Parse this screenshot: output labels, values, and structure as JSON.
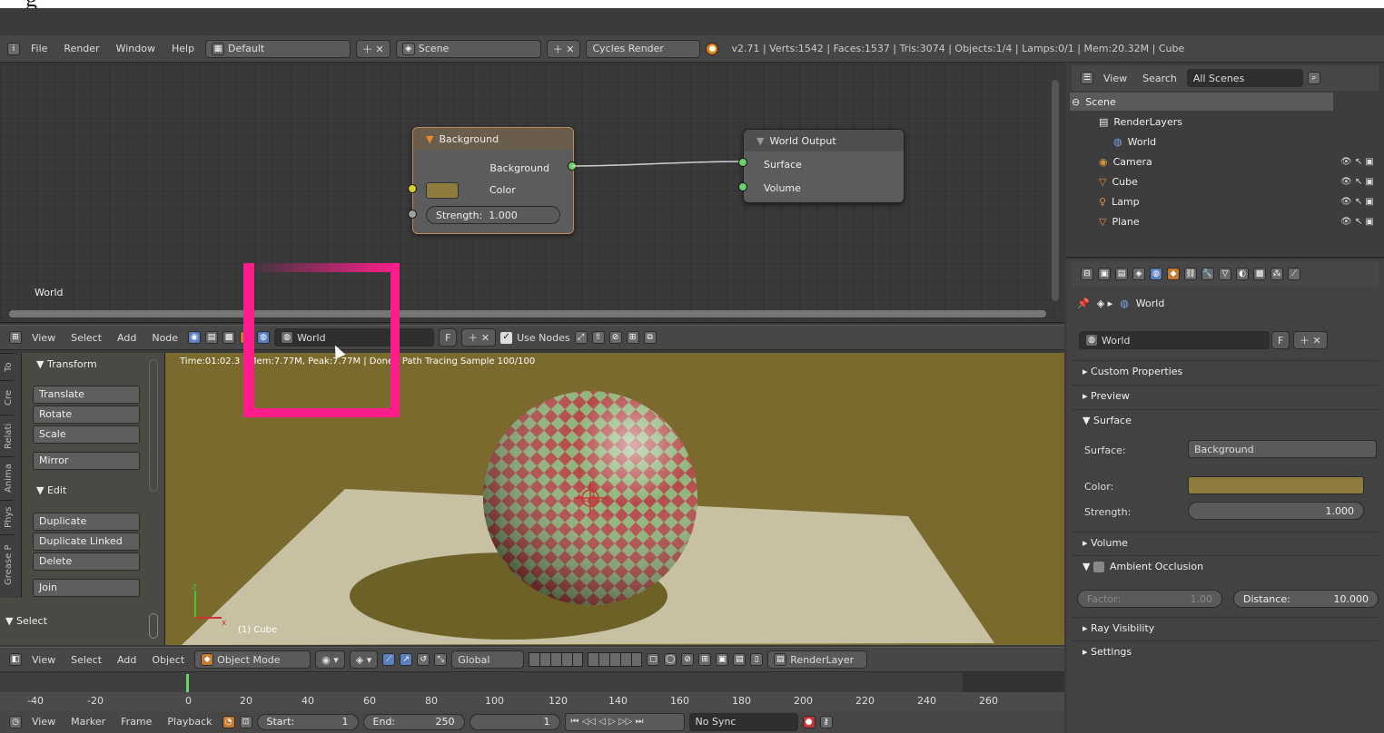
{
  "top_partial_text": "g",
  "info_bar": {
    "menus": [
      "File",
      "Render",
      "Window",
      "Help"
    ],
    "screen_layout": "Default",
    "scene": "Scene",
    "render_engine": "Cycles Render",
    "stats": "v2.71 | Verts:1542 | Faces:1537 | Tris:3074 | Objects:1/4 | Lamps:0/1 | Mem:20.32M | Cube"
  },
  "node_editor": {
    "background_node": {
      "title": "Background",
      "output": "Background",
      "color_label": "Color",
      "strength_label": "Strength:",
      "strength_value": "1.000"
    },
    "output_node": {
      "title": "World Output",
      "surface": "Surface",
      "volume": "Volume"
    },
    "context_label": "World",
    "header": {
      "menus": [
        "View",
        "Select",
        "Add",
        "Node"
      ],
      "world_field": "World",
      "fake_user": "F",
      "use_nodes_label": "Use Nodes"
    }
  },
  "viewport": {
    "info": "Time:01:02.3 | Mem:7.77M, Peak:7.77M | Done | Path Tracing Sample 100/100",
    "object_label": "(1) Cube",
    "tool_tabs": [
      "To",
      "Cre",
      "Relati",
      "Anima",
      "Phys",
      "Grease P"
    ],
    "transform_title": "Transform",
    "transform_tools": [
      "Translate",
      "Rotate",
      "Scale"
    ],
    "mirror": "Mirror",
    "edit_title": "Edit",
    "edit_tools": [
      "Duplicate",
      "Duplicate Linked",
      "Delete"
    ],
    "join": "Join",
    "select_title": "Select",
    "header": {
      "menus": [
        "View",
        "Select",
        "Add",
        "Object"
      ],
      "mode": "Object Mode",
      "orientation": "Global",
      "render_layer": "RenderLayer"
    }
  },
  "outliner": {
    "header": {
      "view": "View",
      "search": "Search",
      "filter": "All Scenes"
    },
    "items": [
      {
        "label": "Scene",
        "icon": "scene-icon"
      },
      {
        "label": "RenderLayers",
        "icon": "render-layers-icon"
      },
      {
        "label": "World",
        "icon": "world-icon"
      },
      {
        "label": "Camera",
        "icon": "camera-icon"
      },
      {
        "label": "Cube",
        "icon": "mesh-icon"
      },
      {
        "label": "Lamp",
        "icon": "lamp-icon"
      },
      {
        "label": "Plane",
        "icon": "mesh-icon"
      }
    ]
  },
  "properties": {
    "breadcrumb": "World",
    "world_field": "World",
    "fake_user": "F",
    "sections": {
      "custom_properties": "Custom Properties",
      "preview": "Preview",
      "surface": "Surface",
      "volume": "Volume",
      "ambient_occlusion": "Ambient Occlusion",
      "ray_visibility": "Ray Visibility",
      "settings": "Settings"
    },
    "surface_label": "Surface:",
    "surface_value": "Background",
    "color_label": "Color:",
    "strength_label": "Strength:",
    "strength_value": "1.000",
    "factor_label": "Factor:",
    "factor_value": "1.00",
    "distance_label": "Distance:",
    "distance_value": "10.000"
  },
  "timeline": {
    "ruler": [
      "-40",
      "-20",
      "0",
      "20",
      "40",
      "60",
      "80",
      "100",
      "120",
      "140",
      "160",
      "180",
      "200",
      "220",
      "240",
      "260"
    ],
    "menus": [
      "View",
      "Marker",
      "Frame",
      "Playback"
    ],
    "start_label": "Start:",
    "start_value": "1",
    "end_label": "End:",
    "end_value": "250",
    "current_frame": "1",
    "sync": "No Sync"
  },
  "colors": {
    "highlight": "#ff1d8e",
    "world_color": "#8d7c3e",
    "socket_green": "#6ad26a",
    "socket_yellow": "#d8cc2a"
  }
}
